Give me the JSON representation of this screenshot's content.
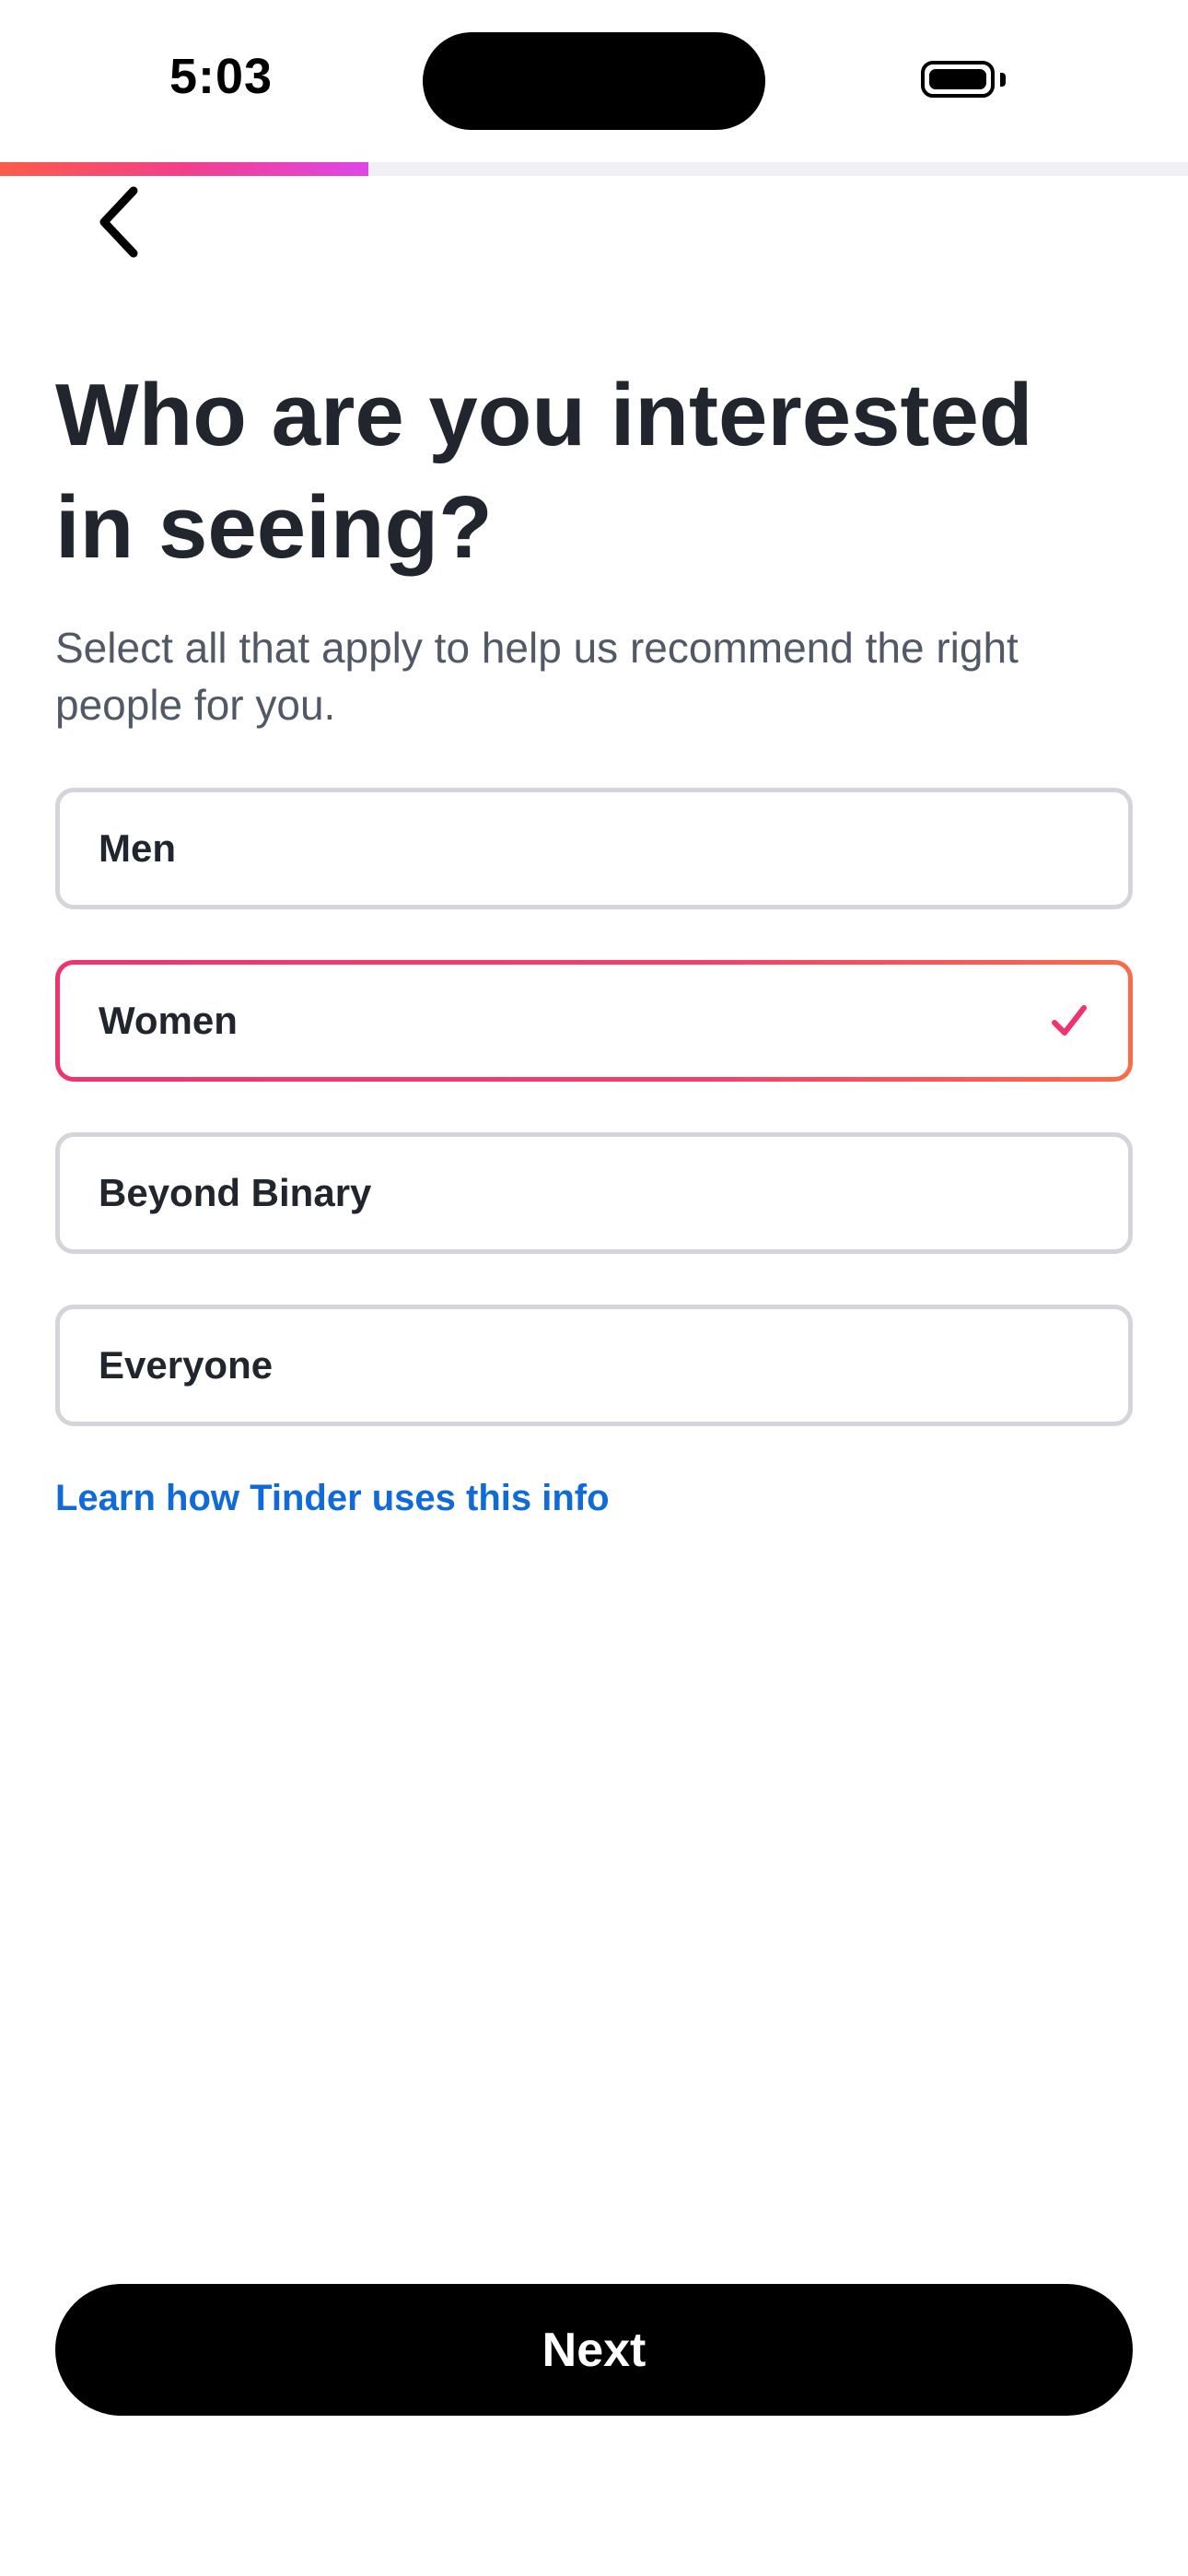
{
  "status_bar": {
    "time": "5:03",
    "battery_icon": "battery-icon"
  },
  "progress": {
    "fraction": 0.31,
    "colors": [
      "#fd5b48",
      "#f33f8b",
      "#e045e8"
    ]
  },
  "nav": {
    "back_icon": "chevron-left-icon"
  },
  "header": {
    "title": "Who are you interested in seeing?",
    "subtitle": "Select all that apply to help us recommend the right people for you."
  },
  "options": [
    {
      "label": "Men",
      "selected": false
    },
    {
      "label": "Women",
      "selected": true
    },
    {
      "label": "Beyond Binary",
      "selected": false
    },
    {
      "label": "Everyone",
      "selected": false
    }
  ],
  "link": {
    "label": "Learn how Tinder uses this info"
  },
  "footer": {
    "next_label": "Next"
  },
  "colors": {
    "accent": "#f0336d",
    "link": "#106bd8",
    "border": "#d4d4da",
    "text": "#21262e"
  }
}
